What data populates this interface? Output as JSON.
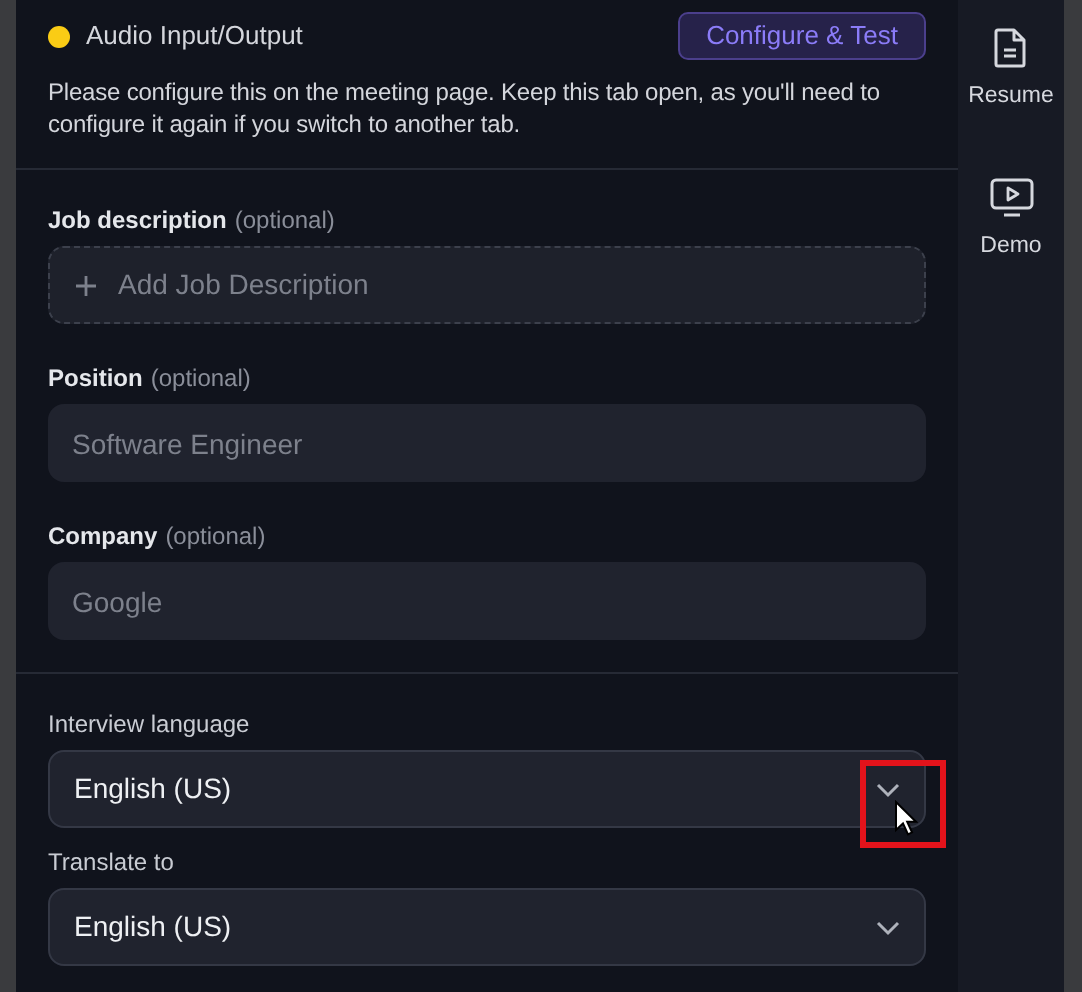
{
  "audio": {
    "label": "Audio Input/Output",
    "color": "#facc15",
    "button": "Configure & Test",
    "note": "Please configure this on the meeting page. Keep this tab open, as you'll need to configure it again if you switch to another tab."
  },
  "fields": [
    {
      "kind": "add",
      "label": "Job description",
      "hint": "(optional)",
      "placeholder": "Add Job Description"
    },
    {
      "kind": "text",
      "label": "Position",
      "hint": "(optional)",
      "placeholder": "Software Engineer"
    },
    {
      "kind": "text",
      "label": "Company",
      "hint": "(optional)",
      "placeholder": "Google"
    }
  ],
  "selects": [
    {
      "label": "Interview language",
      "value": "English (US)",
      "highlighted": true
    },
    {
      "label": "Translate to",
      "value": "English (US)",
      "highlighted": false
    }
  ],
  "sidebar": {
    "items": [
      {
        "kind": "resume",
        "label": "Resume"
      },
      {
        "kind": "demo",
        "label": "Demo"
      }
    ]
  }
}
